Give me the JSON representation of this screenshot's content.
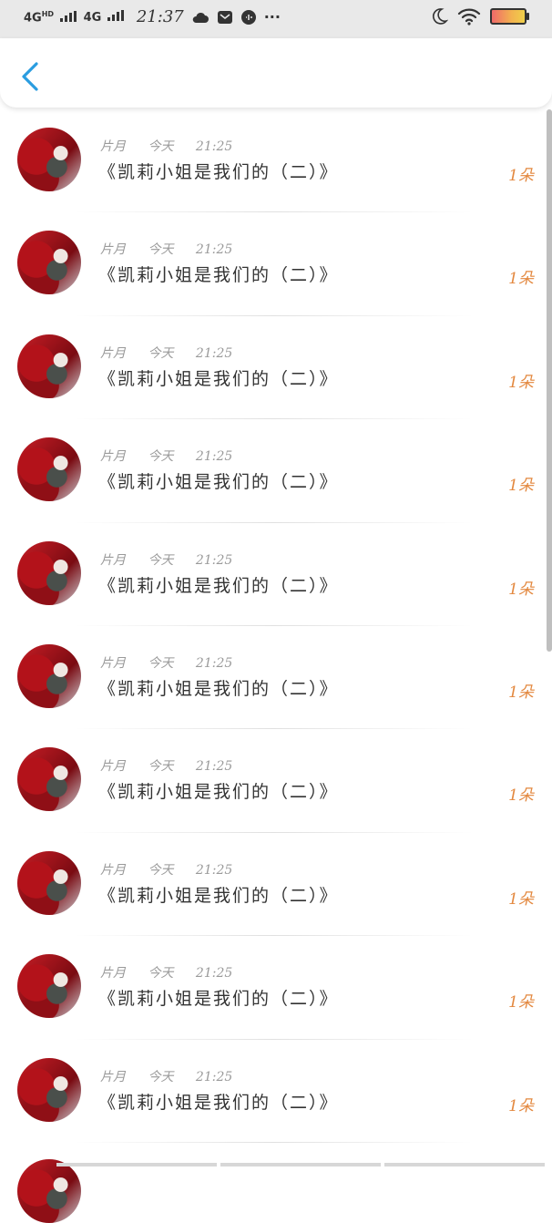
{
  "status_bar": {
    "network1": "4G",
    "network1_sup": "HD",
    "network2": "4G",
    "time": "21:37",
    "icons": [
      "cloud-icon",
      "mail-icon",
      "audio-icon",
      "more-dots-icon",
      "moon-icon",
      "wifi-icon",
      "battery-icon"
    ],
    "more": "···"
  },
  "header": {
    "back_icon": "chevron-left-icon",
    "accent": "#2a9de0"
  },
  "messages": [
    {
      "author": "片月",
      "date": "今天",
      "time": "21:25",
      "title": "《凯莉小姐是我们的（二）》",
      "count": "1朵"
    },
    {
      "author": "片月",
      "date": "今天",
      "time": "21:25",
      "title": "《凯莉小姐是我们的（二）》",
      "count": "1朵"
    },
    {
      "author": "片月",
      "date": "今天",
      "time": "21:25",
      "title": "《凯莉小姐是我们的（二）》",
      "count": "1朵"
    },
    {
      "author": "片月",
      "date": "今天",
      "time": "21:25",
      "title": "《凯莉小姐是我们的（二）》",
      "count": "1朵"
    },
    {
      "author": "片月",
      "date": "今天",
      "time": "21:25",
      "title": "《凯莉小姐是我们的（二）》",
      "count": "1朵"
    },
    {
      "author": "片月",
      "date": "今天",
      "time": "21:25",
      "title": "《凯莉小姐是我们的（二）》",
      "count": "1朵"
    },
    {
      "author": "片月",
      "date": "今天",
      "time": "21:25",
      "title": "《凯莉小姐是我们的（二）》",
      "count": "1朵"
    },
    {
      "author": "片月",
      "date": "今天",
      "time": "21:25",
      "title": "《凯莉小姐是我们的（二）》",
      "count": "1朵"
    },
    {
      "author": "片月",
      "date": "今天",
      "time": "21:25",
      "title": "《凯莉小姐是我们的（二）》",
      "count": "1朵"
    },
    {
      "author": "片月",
      "date": "今天",
      "time": "21:25",
      "title": "《凯莉小姐是我们的（二）》",
      "count": "1朵"
    }
  ],
  "colors": {
    "count": "#e3883f",
    "meta": "#9a9a9a",
    "title": "#333333"
  }
}
